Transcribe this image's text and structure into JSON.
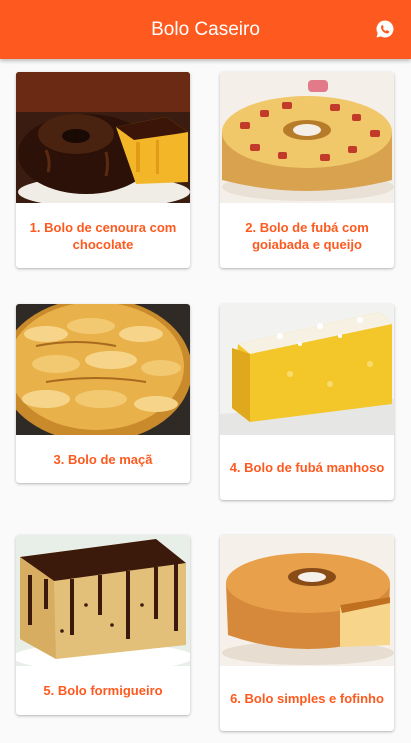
{
  "app": {
    "title": "Bolo Caseiro",
    "action_icon": "whatsapp-icon",
    "accent": "#fe5a1f"
  },
  "recipes": [
    {
      "label": "1. Bolo de cenoura com chocolate",
      "image": "carrot-cake-chocolate"
    },
    {
      "label": "2. Bolo de fubá com goiabada e queijo",
      "image": "cornmeal-guava-cheese-cake"
    },
    {
      "label": "3. Bolo de maçã",
      "image": "apple-cake"
    },
    {
      "label": "4. Bolo de fubá manhoso",
      "image": "creamy-cornmeal-cake"
    },
    {
      "label": "5. Bolo formigueiro",
      "image": "sprinkle-cake"
    },
    {
      "label": "6. Bolo simples e fofinho",
      "image": "simple-fluffy-cake"
    }
  ]
}
